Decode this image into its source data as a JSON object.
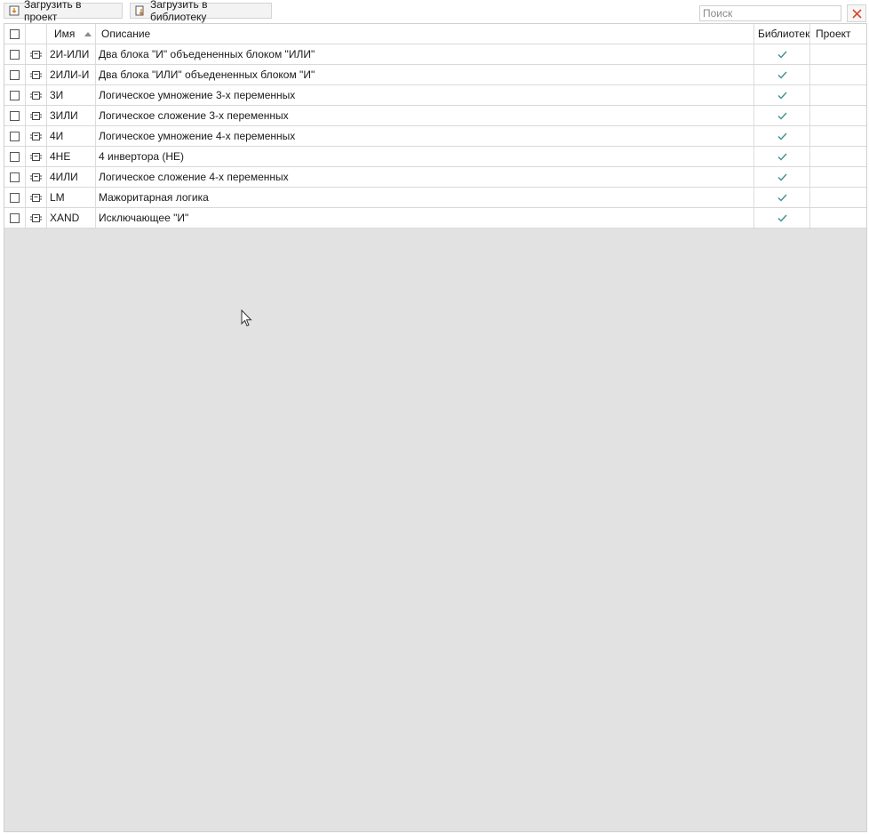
{
  "toolbar": {
    "load_to_project_label": "Загрузить в проект",
    "load_to_library_label": "Загрузить в библиотеку"
  },
  "search": {
    "placeholder": "Поиск",
    "value": ""
  },
  "table": {
    "columns": {
      "name": "Имя",
      "description": "Описание",
      "library": "Библиотека",
      "project": "Проект"
    },
    "sort": {
      "column": "name",
      "direction": "ascending"
    },
    "rows": [
      {
        "name": "2И-ИЛИ",
        "description": "Два блока \"И\" объедененных блоком \"ИЛИ\"",
        "in_library": true,
        "in_project": false,
        "checked": false
      },
      {
        "name": "2ИЛИ-И",
        "description": "Два блока \"ИЛИ\" объедененных блоком \"И\"",
        "in_library": true,
        "in_project": false,
        "checked": false
      },
      {
        "name": "3И",
        "description": "Логическое умножение 3-х переменных",
        "in_library": true,
        "in_project": false,
        "checked": false
      },
      {
        "name": "3ИЛИ",
        "description": "Логическое сложение 3-х переменных",
        "in_library": true,
        "in_project": false,
        "checked": false
      },
      {
        "name": "4И",
        "description": "Логическое умножение 4-х переменных",
        "in_library": true,
        "in_project": false,
        "checked": false
      },
      {
        "name": "4НЕ",
        "description": "4 инвертора (НЕ)",
        "in_library": true,
        "in_project": false,
        "checked": false
      },
      {
        "name": "4ИЛИ",
        "description": "Логическое сложение 4-х переменных",
        "in_library": true,
        "in_project": false,
        "checked": false
      },
      {
        "name": "LM",
        "description": "Мажоритарная логика",
        "in_library": true,
        "in_project": false,
        "checked": false
      },
      {
        "name": "XAND",
        "description": "Исключающее \"И\"",
        "in_library": true,
        "in_project": false,
        "checked": false
      }
    ]
  },
  "colors": {
    "check_mark": "#3f8f8f",
    "clear_icon": "#d9482b",
    "empty_area": "#e2e2e2",
    "grid_line": "#d9d9d9"
  },
  "icons": {
    "row_icon": "chip-block-icon",
    "load_to_project": "download-to-project-icon",
    "load_to_library": "download-to-library-icon",
    "clear": "close-icon",
    "check": "check-icon"
  }
}
